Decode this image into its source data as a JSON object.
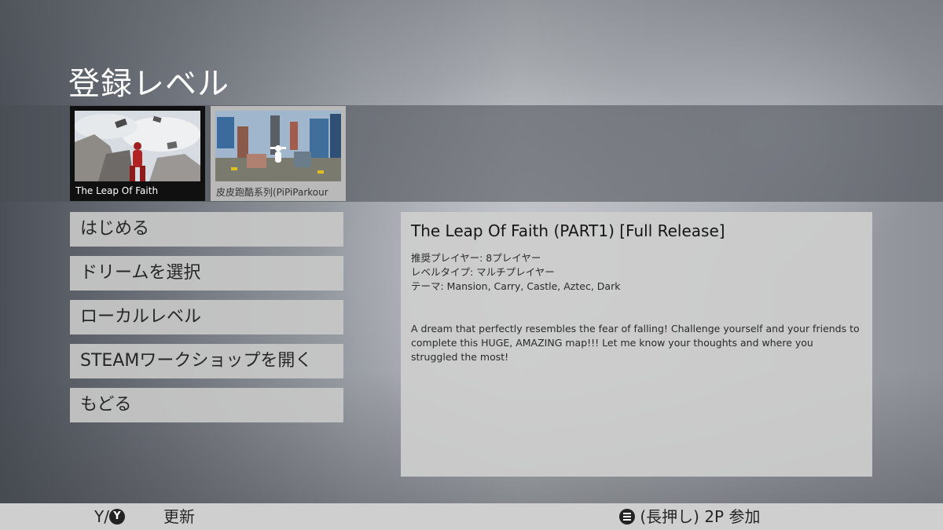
{
  "page": {
    "title": "登録レベル"
  },
  "levels": [
    {
      "caption": "The Leap Of Faith",
      "selected": true
    },
    {
      "caption": "皮皮跑酷系列(PiPiParkour",
      "selected": false
    }
  ],
  "menu": {
    "start": "はじめる",
    "select_dream": "ドリームを選択",
    "local_level": "ローカルレベル",
    "steam_workshop": "STEAMワークショップを開く",
    "back": "もどる"
  },
  "details": {
    "title": "The Leap Of Faith (PART1) [Full Release]",
    "players": "推奨プレイヤー: 8プレイヤー",
    "level_type": "レベルタイプ: マルチプレイヤー",
    "theme": "テーマ: Mansion, Carry, Castle, Aztec, Dark",
    "description": "A dream that perfectly resembles the fear of falling! Challenge yourself and your friends to complete this HUGE, AMAZING map!!! Let me know your thoughts and where you struggled the most!"
  },
  "footer": {
    "refresh_key": "Y/",
    "refresh_key_glyph": "Y",
    "refresh_label": "更新",
    "join_label": "(長押し) 2P 参加"
  },
  "icons": [
    "y-button-icon",
    "menu-button-icon"
  ],
  "colors": {
    "selected_thumb_border": "#101010",
    "button_bg": "#c8c8c8",
    "footer_bg": "#cfcfcf"
  }
}
